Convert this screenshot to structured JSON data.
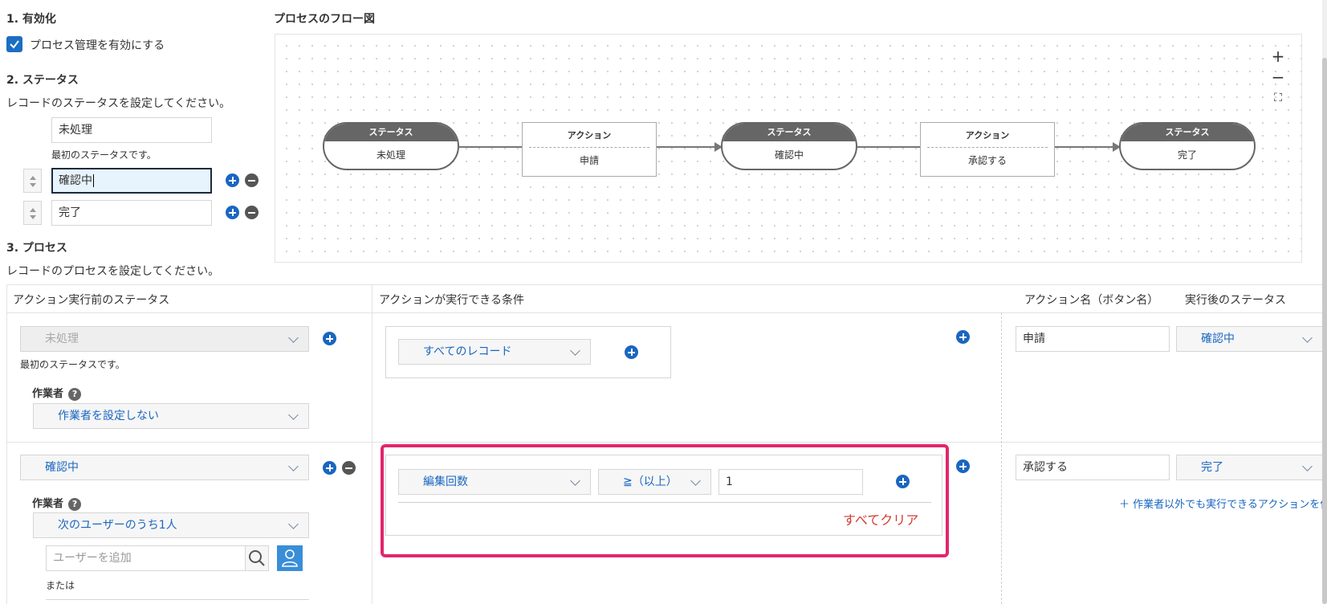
{
  "section1": {
    "heading": "1. 有効化",
    "checkbox_label": "プロセス管理を有効にする",
    "checked": true
  },
  "section2": {
    "heading": "2. ステータス",
    "description": "レコードのステータスを設定してください。",
    "statuses": [
      {
        "value": "未処理",
        "note": "最初のステータスです。"
      },
      {
        "value": "確認中"
      },
      {
        "value": "完了"
      }
    ]
  },
  "flow": {
    "heading": "プロセスのフロー図",
    "status_label": "ステータス",
    "action_label": "アクション",
    "nodes": [
      "未処理",
      "申請",
      "確認中",
      "承認する",
      "完了"
    ],
    "zoom_in": "+",
    "zoom_out": "−",
    "fit": "⛶"
  },
  "section3": {
    "heading": "3. プロセス",
    "description": "レコードのプロセスを設定してください。",
    "columns": [
      "アクション実行前のステータス",
      "アクションが実行できる条件",
      "アクション名（ボタン名）",
      "実行後のステータス"
    ],
    "rows": [
      {
        "status": "未処理",
        "status_note": "最初のステータスです。",
        "assignee_label": "作業者",
        "assignee": "作業者を設定しない",
        "condition_field": "すべてのレコード",
        "action_name": "申請",
        "next_status": "確認中"
      },
      {
        "status": "確認中",
        "assignee_label": "作業者",
        "assignee": "次のユーザーのうち1人",
        "user_placeholder": "ユーザーを追加",
        "or_label": "または",
        "condition_field": "編集回数",
        "condition_op": "≧（以上）",
        "condition_value": "1",
        "clear_all": "すべてクリア",
        "action_name": "承認する",
        "next_status": "完了",
        "add_non_assignee_action": "作業者以外でも実行できるアクションを作成"
      }
    ]
  },
  "colors": {
    "accent": "#1a66c0",
    "highlight": "#e3256b",
    "danger": "#d23c2f"
  }
}
